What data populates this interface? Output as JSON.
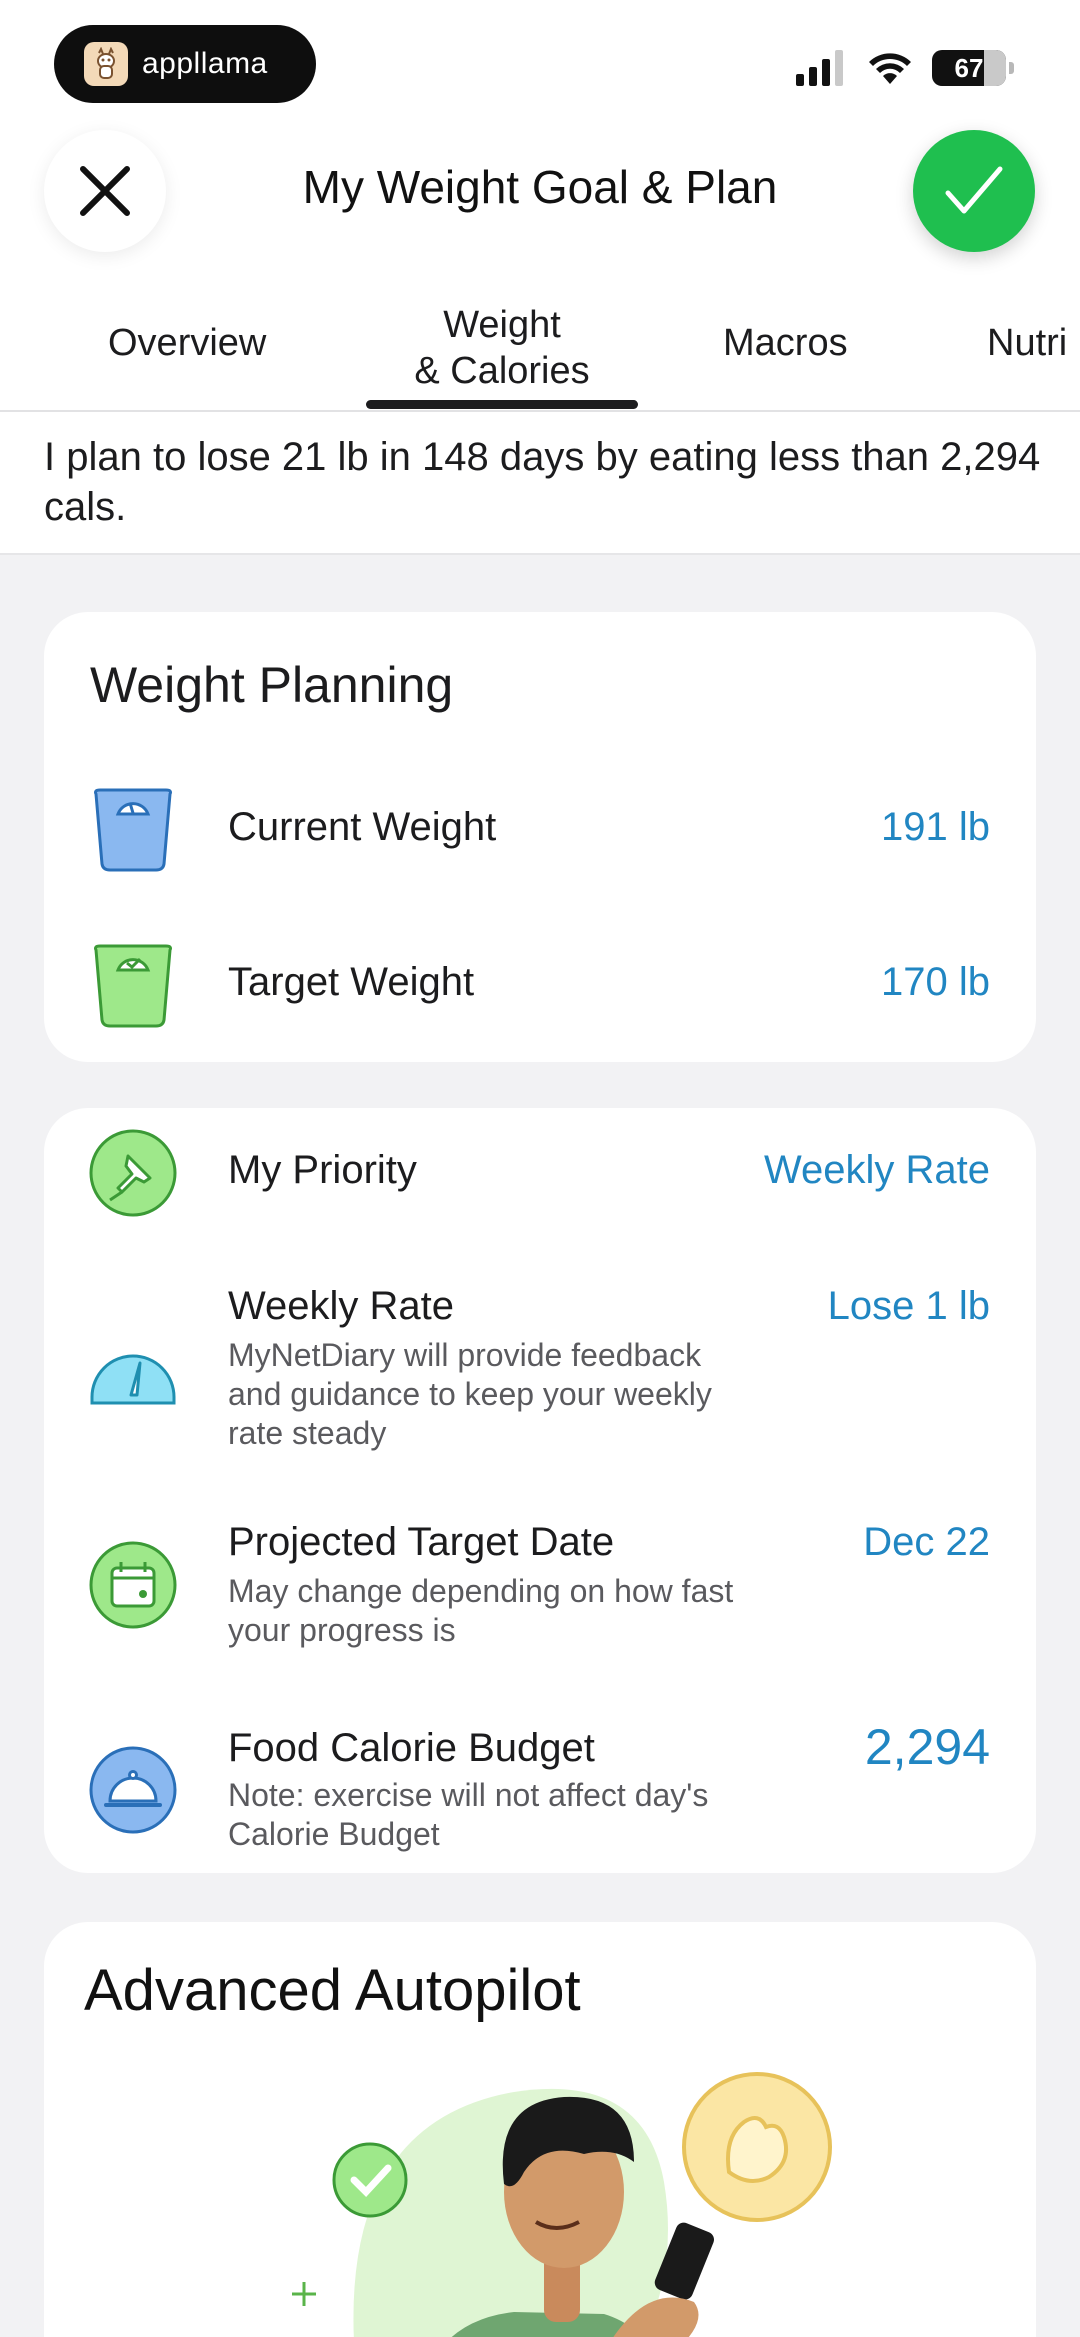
{
  "status_bar": {
    "badge_text": "appllama",
    "battery": "67"
  },
  "header": {
    "title": "My Weight Goal & Plan"
  },
  "tabs": [
    {
      "label": "Overview"
    },
    {
      "label_line1": "Weight",
      "label_line2": "& Calories",
      "selected": true
    },
    {
      "label": "Macros"
    },
    {
      "label": "Nutri"
    }
  ],
  "plan_summary": "I plan to lose 21 lb in 148 days by eating less than 2,294 cals.",
  "weight_planning": {
    "title": "Weight Planning",
    "current_weight": {
      "label": "Current Weight",
      "value": "191 lb"
    },
    "target_weight": {
      "label": "Target Weight",
      "value": "170 lb"
    }
  },
  "plan_details": {
    "priority": {
      "label": "My Priority",
      "value": "Weekly Rate"
    },
    "weekly_rate": {
      "label": "Weekly Rate",
      "value": "Lose 1 lb",
      "sub_line1": "MyNetDiary will provide feedback",
      "sub_line2": "and guidance to keep your weekly",
      "sub_line3": "rate steady"
    },
    "target_date": {
      "label": "Projected Target Date",
      "value": "Dec 22",
      "sub_line1": "May change depending on how fast",
      "sub_line2": "your progress is"
    },
    "calorie_budget": {
      "label": "Food Calorie Budget",
      "value": "2,294",
      "sub_line1": "Note: exercise will not affect day's",
      "sub_line2": "Calorie Budget"
    }
  },
  "autopilot": {
    "title": "Advanced Autopilot"
  },
  "colors": {
    "accent_blue": "#2186c2",
    "confirm_green": "#1fbf4f",
    "scale_blue": "#8ab8f0",
    "scale_green": "#9ee88a"
  }
}
